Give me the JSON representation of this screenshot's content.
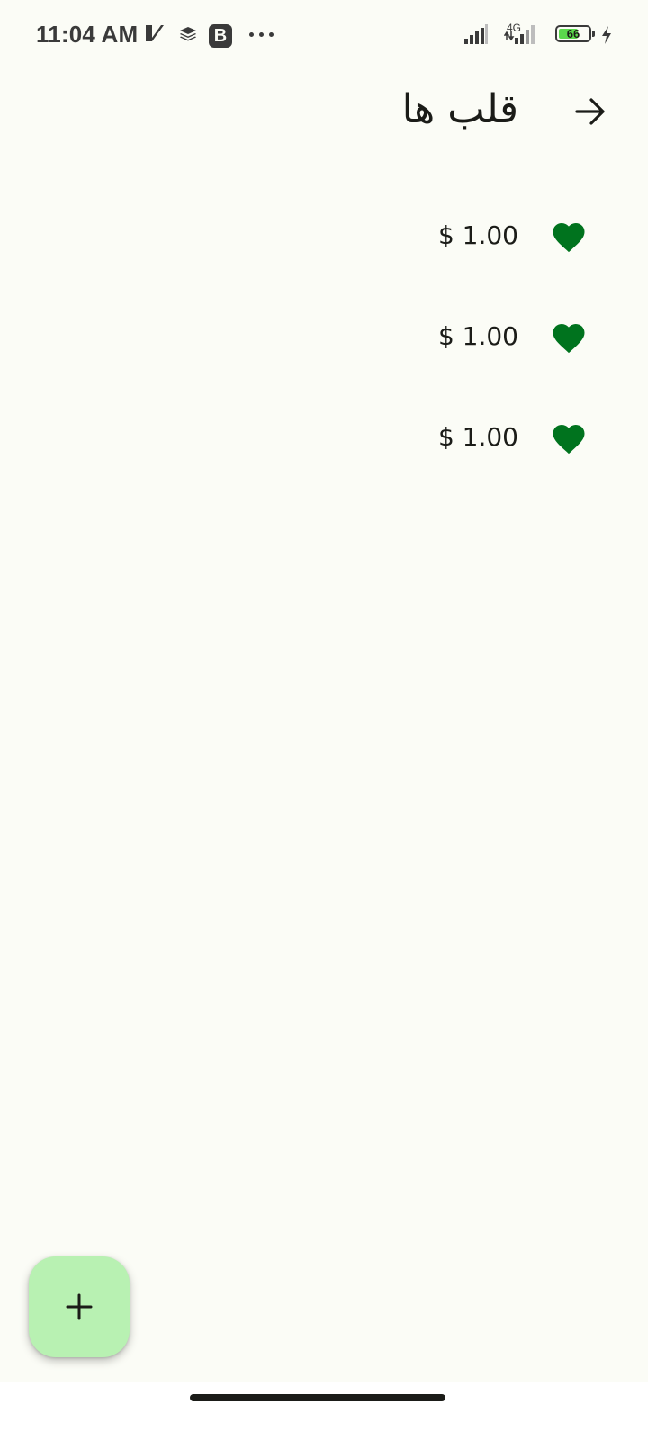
{
  "status_bar": {
    "time": "11:04 AM",
    "network_type": "4G",
    "battery_level": "66",
    "battery_fraction": 0.66,
    "icons": [
      "vpn-check-icon",
      "layers-icon",
      "b-app-icon",
      "more-dots-icon",
      "signal-icon",
      "signal-icon",
      "battery-icon",
      "charging-bolt-icon"
    ]
  },
  "app_bar": {
    "title": "قلب ها",
    "back_icon": "arrow-back-icon"
  },
  "items": [
    {
      "price": "$ 1.00",
      "icon": "heart-icon"
    },
    {
      "price": "$ 1.00",
      "icon": "heart-icon"
    },
    {
      "price": "$ 1.00",
      "icon": "heart-icon"
    }
  ],
  "fab": {
    "icon": "plus-icon"
  },
  "colors": {
    "background": "#fbfcf6",
    "heart": "#00731e",
    "fab": "#b8f1b2",
    "text": "#1b1c18"
  }
}
